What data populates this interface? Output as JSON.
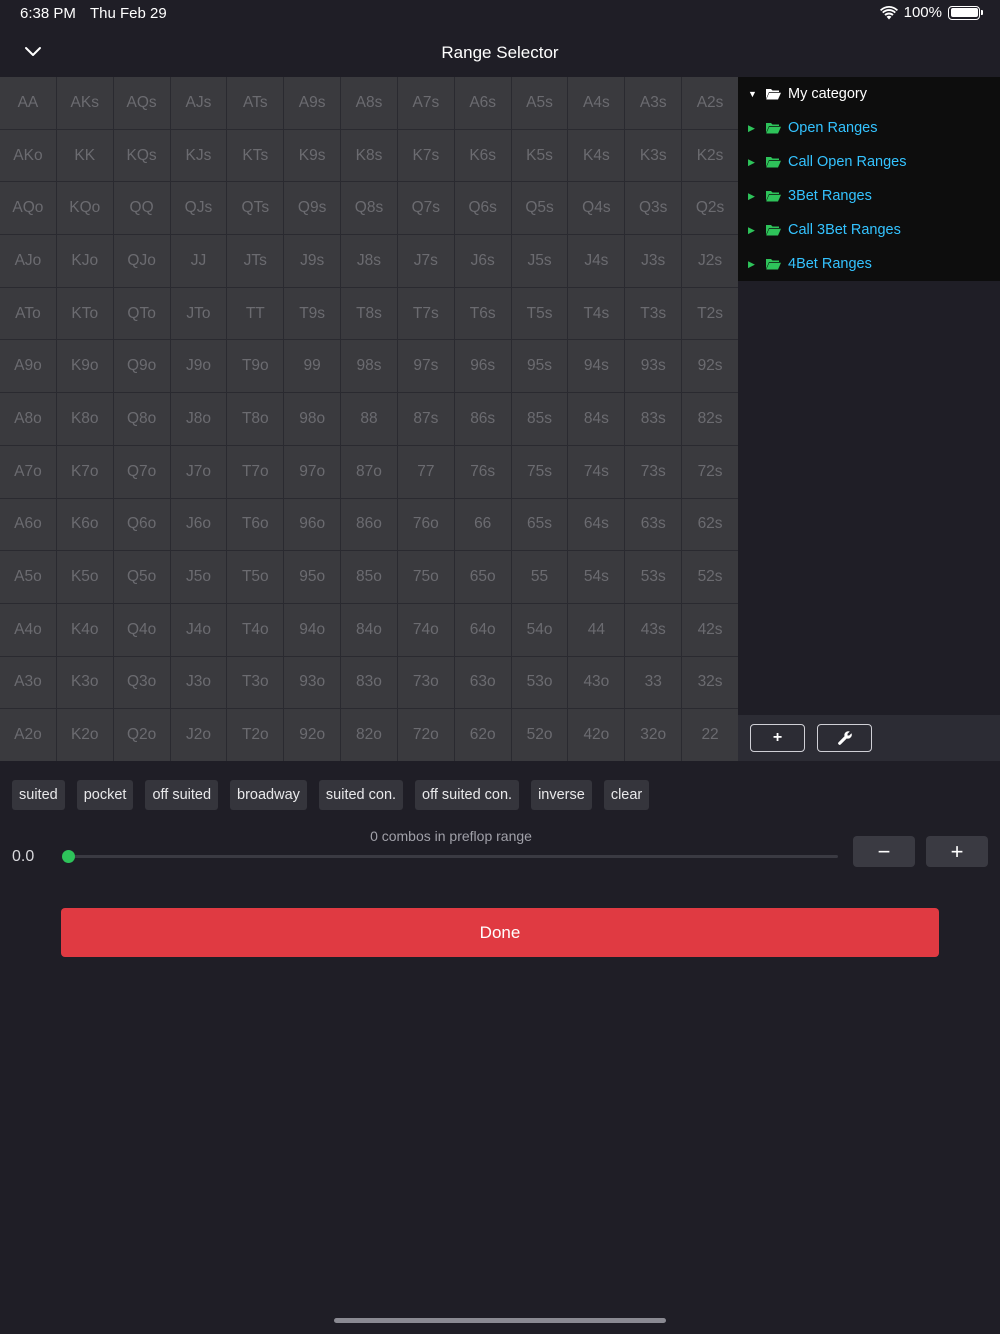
{
  "status_bar": {
    "time": "6:38 PM",
    "date": "Thu Feb 29",
    "battery": "100%"
  },
  "header": {
    "title": "Range Selector"
  },
  "hand_grid": [
    [
      "AA",
      "AKs",
      "AQs",
      "AJs",
      "ATs",
      "A9s",
      "A8s",
      "A7s",
      "A6s",
      "A5s",
      "A4s",
      "A3s",
      "A2s"
    ],
    [
      "AKo",
      "KK",
      "KQs",
      "KJs",
      "KTs",
      "K9s",
      "K8s",
      "K7s",
      "K6s",
      "K5s",
      "K4s",
      "K3s",
      "K2s"
    ],
    [
      "AQo",
      "KQo",
      "QQ",
      "QJs",
      "QTs",
      "Q9s",
      "Q8s",
      "Q7s",
      "Q6s",
      "Q5s",
      "Q4s",
      "Q3s",
      "Q2s"
    ],
    [
      "AJo",
      "KJo",
      "QJo",
      "JJ",
      "JTs",
      "J9s",
      "J8s",
      "J7s",
      "J6s",
      "J5s",
      "J4s",
      "J3s",
      "J2s"
    ],
    [
      "ATo",
      "KTo",
      "QTo",
      "JTo",
      "TT",
      "T9s",
      "T8s",
      "T7s",
      "T6s",
      "T5s",
      "T4s",
      "T3s",
      "T2s"
    ],
    [
      "A9o",
      "K9o",
      "Q9o",
      "J9o",
      "T9o",
      "99",
      "98s",
      "97s",
      "96s",
      "95s",
      "94s",
      "93s",
      "92s"
    ],
    [
      "A8o",
      "K8o",
      "Q8o",
      "J8o",
      "T8o",
      "98o",
      "88",
      "87s",
      "86s",
      "85s",
      "84s",
      "83s",
      "82s"
    ],
    [
      "A7o",
      "K7o",
      "Q7o",
      "J7o",
      "T7o",
      "97o",
      "87o",
      "77",
      "76s",
      "75s",
      "74s",
      "73s",
      "72s"
    ],
    [
      "A6o",
      "K6o",
      "Q6o",
      "J6o",
      "T6o",
      "96o",
      "86o",
      "76o",
      "66",
      "65s",
      "64s",
      "63s",
      "62s"
    ],
    [
      "A5o",
      "K5o",
      "Q5o",
      "J5o",
      "T5o",
      "95o",
      "85o",
      "75o",
      "65o",
      "55",
      "54s",
      "53s",
      "52s"
    ],
    [
      "A4o",
      "K4o",
      "Q4o",
      "J4o",
      "T4o",
      "94o",
      "84o",
      "74o",
      "64o",
      "54o",
      "44",
      "43s",
      "42s"
    ],
    [
      "A3o",
      "K3o",
      "Q3o",
      "J3o",
      "T3o",
      "93o",
      "83o",
      "73o",
      "63o",
      "53o",
      "43o",
      "33",
      "32s"
    ],
    [
      "A2o",
      "K2o",
      "Q2o",
      "J2o",
      "T2o",
      "92o",
      "82o",
      "72o",
      "62o",
      "52o",
      "42o",
      "32o",
      "22"
    ]
  ],
  "categories": {
    "root": "My category",
    "items": [
      "Open Ranges",
      "Call Open Ranges",
      "3Bet Ranges",
      "Call 3Bet Ranges",
      "4Bet Ranges"
    ]
  },
  "side_toolbar": {
    "add_label": "+"
  },
  "filters": [
    "suited",
    "pocket",
    "off suited",
    "broadway",
    "suited con.",
    "off suited con.",
    "inverse",
    "clear"
  ],
  "slider": {
    "combos_text": "0 combos in preflop range",
    "value_label": "0.0",
    "value": 0.0
  },
  "steppers": {
    "minus": "−",
    "plus": "+"
  },
  "done_label": "Done",
  "colors": {
    "accent_green": "#2ec35a",
    "link_blue": "#34c3ff",
    "done_red": "#e03a42",
    "cell_bg": "#3a3a3e"
  }
}
